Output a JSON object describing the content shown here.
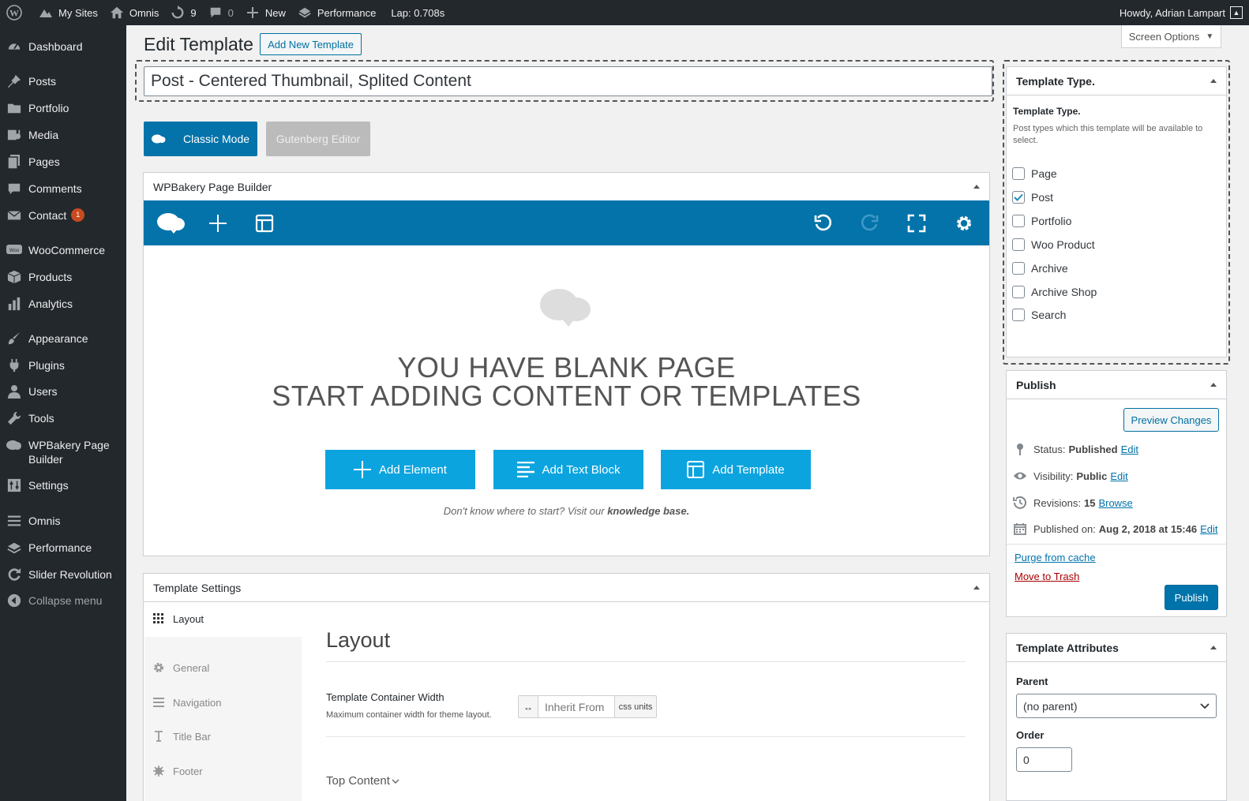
{
  "admin_bar": {
    "my_sites": "My Sites",
    "site_name": "Omnis",
    "updates_count": "9",
    "comments_count": "0",
    "new_label": "New",
    "performance_label": "Performance",
    "lap_text": "Lap: 0.708s",
    "howdy": "Howdy, Adrian Lampart"
  },
  "menu": {
    "items": [
      {
        "label": "Dashboard",
        "icon": "dashboard-icon"
      },
      {
        "label": "Posts",
        "icon": "pin-icon"
      },
      {
        "label": "Portfolio",
        "icon": "folder-icon"
      },
      {
        "label": "Media",
        "icon": "media-icon"
      },
      {
        "label": "Pages",
        "icon": "pages-icon"
      },
      {
        "label": "Comments",
        "icon": "comment-icon"
      },
      {
        "label": "Contact",
        "icon": "mail-icon",
        "badge": "1"
      },
      {
        "label": "WooCommerce",
        "icon": "woo-icon"
      },
      {
        "label": "Products",
        "icon": "box-icon"
      },
      {
        "label": "Analytics",
        "icon": "bar-chart-icon"
      },
      {
        "label": "Appearance",
        "icon": "brush-icon"
      },
      {
        "label": "Plugins",
        "icon": "plug-icon"
      },
      {
        "label": "Users",
        "icon": "user-icon"
      },
      {
        "label": "Tools",
        "icon": "wrench-icon"
      },
      {
        "label": "WPBakery Page Builder",
        "icon": "cloud-icon"
      },
      {
        "label": "Settings",
        "icon": "sliders-icon"
      },
      {
        "label": "Omnis",
        "icon": "list-icon"
      },
      {
        "label": "Performance",
        "icon": "speed-icon"
      },
      {
        "label": "Slider Revolution",
        "icon": "refresh-icon"
      },
      {
        "label": "Collapse menu",
        "icon": "collapse-icon"
      }
    ]
  },
  "header": {
    "title": "Edit Template",
    "add_new": "Add New Template",
    "screen_options": "Screen Options"
  },
  "post_title": "Post - Centered Thumbnail, Splited Content",
  "editor_modes": {
    "classic": "Classic Mode",
    "gutenberg": "Gutenberg Editor"
  },
  "builder": {
    "title": "WPBakery Page Builder",
    "blank_line1": "YOU HAVE BLANK PAGE",
    "blank_line2": "START ADDING CONTENT OR TEMPLATES",
    "add_element": "Add Element",
    "add_text_block": "Add Text Block",
    "add_template": "Add Template",
    "hint_prefix": "Don't know where to start? Visit our",
    "hint_link": "knowledge base."
  },
  "template_settings": {
    "title": "Template Settings",
    "tabs": [
      "Layout",
      "General",
      "Navigation",
      "Title Bar",
      "Footer"
    ],
    "section_title": "Layout",
    "field_label": "Template Container Width",
    "field_desc": "Maximum container width for theme layout.",
    "field_placeholder": "Inherit From",
    "field_unit": "css units",
    "next_section": "Top Content"
  },
  "template_type": {
    "box_title": "Template Type.",
    "heading": "Template Type.",
    "description": "Post types which this template will be available to select.",
    "options": [
      {
        "label": "Page",
        "checked": false
      },
      {
        "label": "Post",
        "checked": true
      },
      {
        "label": "Portfolio",
        "checked": false
      },
      {
        "label": "Woo Product",
        "checked": false
      },
      {
        "label": "Archive",
        "checked": false
      },
      {
        "label": "Archive Shop",
        "checked": false
      },
      {
        "label": "Search",
        "checked": false
      }
    ]
  },
  "publish": {
    "title": "Publish",
    "preview": "Preview Changes",
    "status_label": "Status:",
    "status_value": "Published",
    "visibility_label": "Visibility:",
    "visibility_value": "Public",
    "revisions_label": "Revisions:",
    "revisions_value": "15",
    "browse": "Browse",
    "published_label": "Published on:",
    "published_value": "Aug 2, 2018 at 15:46",
    "edit": "Edit",
    "purge": "Purge from cache",
    "trash": "Move to Trash",
    "publish_button": "Publish"
  },
  "attributes": {
    "title": "Template Attributes",
    "parent_label": "Parent",
    "parent_value": "(no parent)",
    "order_label": "Order",
    "order_value": "0"
  },
  "colors": {
    "accent": "#0473aa",
    "button_blue": "#0ca4df",
    "wp_blue": "#0073aa",
    "menu_bg": "#23282d",
    "trash_red": "#a00"
  }
}
